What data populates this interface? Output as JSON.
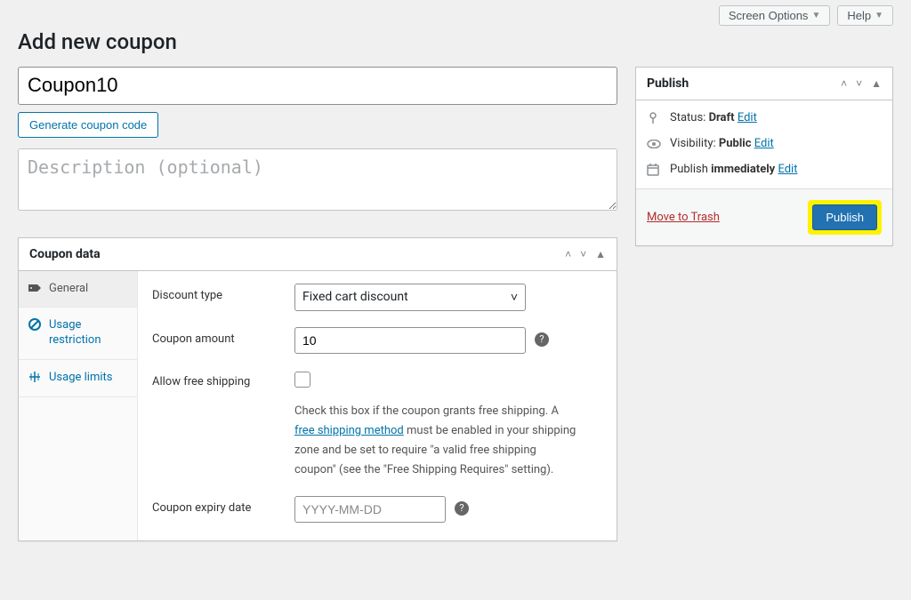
{
  "topbar": {
    "screen_options_label": "Screen Options",
    "help_label": "Help"
  },
  "page_title": "Add new coupon",
  "coupon_code_value": "Coupon10",
  "generate_code_label": "Generate coupon code",
  "description_placeholder": "Description (optional)",
  "coupon_data": {
    "box_title": "Coupon data",
    "tabs": {
      "general": "General",
      "usage_restriction": "Usage restriction",
      "usage_limits": "Usage limits"
    },
    "fields": {
      "discount_type_label": "Discount type",
      "discount_type_value": "Fixed cart discount",
      "coupon_amount_label": "Coupon amount",
      "coupon_amount_value": "10",
      "free_shipping_label": "Allow free shipping",
      "free_shipping_desc_before": "Check this box if the coupon grants free shipping. A ",
      "free_shipping_link": "free shipping method",
      "free_shipping_desc_after": " must be enabled in your shipping zone and be set to require \"a valid free shipping coupon\" (see the \"Free Shipping Requires\" setting).",
      "expiry_label": "Coupon expiry date",
      "expiry_placeholder": "YYYY-MM-DD"
    }
  },
  "publish": {
    "box_title": "Publish",
    "status_label": "Status:",
    "status_value": "Draft",
    "visibility_label": "Visibility:",
    "visibility_value": "Public",
    "schedule_label": "Publish",
    "schedule_value": "immediately",
    "edit_label": "Edit",
    "trash_label": "Move to Trash",
    "publish_button": "Publish"
  }
}
